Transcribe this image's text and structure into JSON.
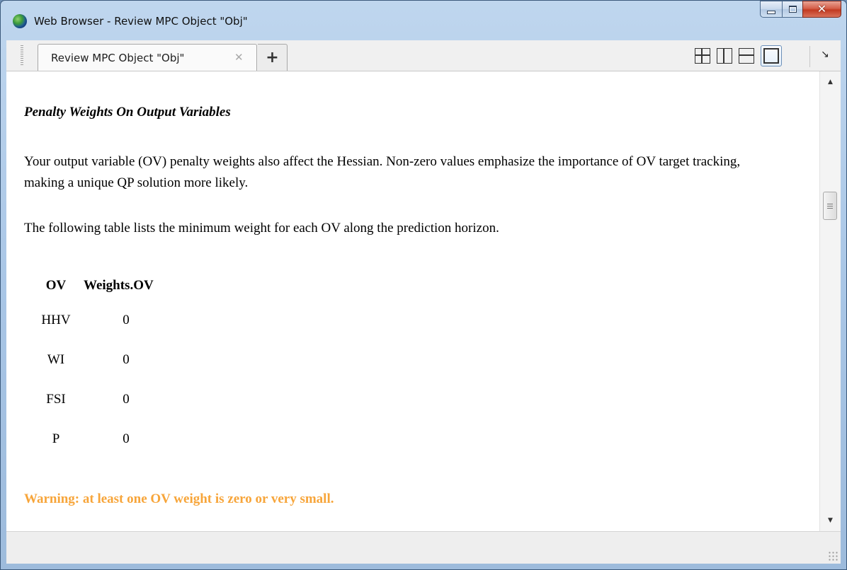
{
  "window": {
    "title": "Web Browser - Review MPC Object \"Obj\"",
    "app_icon": "globe-icon",
    "controls": {
      "minimize": "minimize-icon",
      "maximize": "maximize-icon",
      "close": "close-icon"
    }
  },
  "tabs": {
    "active_label": "Review MPC Object \"Obj\"",
    "close_glyph": "✕",
    "add_glyph": "+"
  },
  "toolbar": {
    "layout_icons": [
      "grid-layout-icon",
      "vertical-split-icon",
      "horizontal-split-icon",
      "single-layout-icon"
    ],
    "dock_glyph": "↘"
  },
  "content": {
    "heading": "Penalty Weights On Output Variables",
    "paragraph1": "Your output variable (OV) penalty weights also affect the Hessian. Non-zero values emphasize the importance of OV target tracking, making a unique QP solution more likely.",
    "paragraph2": "The following table lists the minimum weight for each OV along the prediction horizon.",
    "table": {
      "headers": [
        "OV",
        "Weights.OV"
      ],
      "rows": [
        [
          "HHV",
          "0"
        ],
        [
          "WI",
          "0"
        ],
        [
          "FSI",
          "0"
        ],
        [
          "P",
          "0"
        ]
      ]
    },
    "warning": "Warning: at least one OV weight is zero or very small.",
    "warning_color": "#f7a53a"
  },
  "scrollbar": {
    "up_glyph": "▲",
    "down_glyph": "▼"
  }
}
